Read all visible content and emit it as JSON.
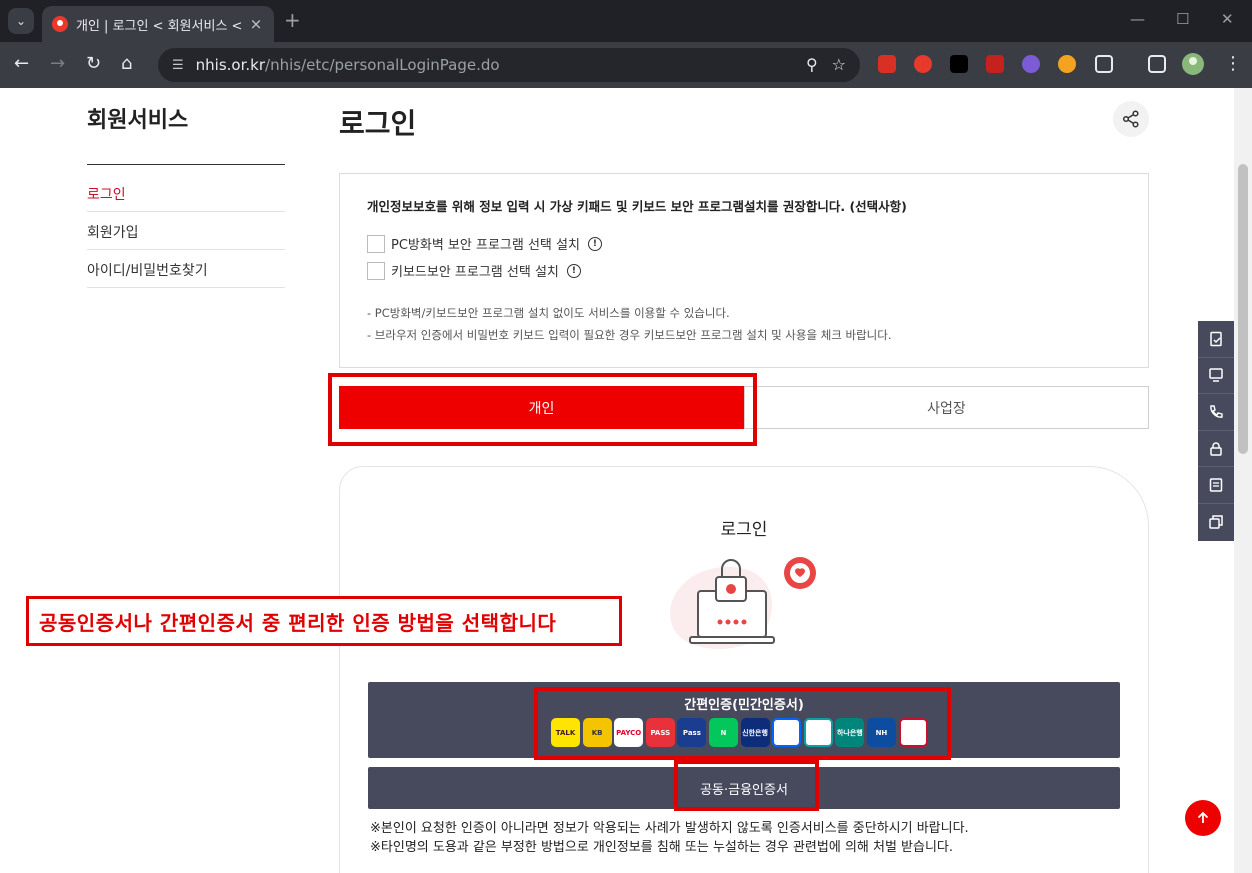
{
  "browser": {
    "tab_title": "개인 | 로그인 < 회원서비스 <",
    "url_host": "nhis.or.kr",
    "url_path": "/nhis/etc/personalLoginPage.do",
    "tab_menu_icon": "chevron-down",
    "new_tab": "+",
    "minimize": "—",
    "maximize": "☐",
    "close": "✕"
  },
  "sidebar": {
    "title": "회원서비스",
    "items": [
      {
        "label": "로그인"
      },
      {
        "label": "회원가입"
      },
      {
        "label": "아이디/비밀번호찾기"
      }
    ]
  },
  "main": {
    "title": "로그인"
  },
  "notice": {
    "heading": "개인정보보호를 위해 정보 입력 시 가상 키패드 및 키보드 보안 프로그램설치를 권장합니다. (선택사항)",
    "options": [
      {
        "label": "PC방화벽 보안 프로그램 선택 설치",
        "checked": false
      },
      {
        "label": "키보드보안 프로그램 선택 설치",
        "checked": false
      }
    ],
    "notes": [
      "-  PC방화벽/키보드보안 프로그램 설치 없이도 서비스를 이용할 수 있습니다.",
      "-  브라우저 인증에서 비밀번호 키보드 입력이 필요한 경우 키보드보안 프로그램 설치 및 사용을 체크 바랍니다."
    ]
  },
  "user_tabs": {
    "individual": "개인",
    "business": "사업장"
  },
  "login_card": {
    "title": "로그인",
    "simple_auth_label": "간편인증(민간인증서)",
    "providers": [
      {
        "name": "kakao",
        "text": "TALK",
        "bg": "#fee500",
        "fg": "#3c1e1e"
      },
      {
        "name": "kb",
        "text": "KB",
        "bg": "#f5c400",
        "fg": "#333"
      },
      {
        "name": "payco",
        "text": "PAYCO",
        "bg": "#ffffff",
        "fg": "#e4002b"
      },
      {
        "name": "pass",
        "text": "PASS",
        "bg": "#e8313b",
        "fg": "#ffffff"
      },
      {
        "name": "samsung-pass",
        "text": "Pass",
        "bg": "#1a3d8f",
        "fg": "#ffffff"
      },
      {
        "name": "naver",
        "text": "N",
        "bg": "#03c75a",
        "fg": "#ffffff"
      },
      {
        "name": "shinhan",
        "text": "신한은행",
        "bg": "#0d2c7a",
        "fg": "#ffffff"
      },
      {
        "name": "toss",
        "text": "",
        "bg": "#ffffff",
        "fg": "#0064ff"
      },
      {
        "name": "woori",
        "text": "",
        "bg": "#ffffff",
        "fg": "#0aa1a5"
      },
      {
        "name": "hana",
        "text": "하나은행",
        "bg": "#00857a",
        "fg": "#ffffff"
      },
      {
        "name": "nh",
        "text": "NH",
        "bg": "#0c4da2",
        "fg": "#ffffff"
      },
      {
        "name": "banksalad",
        "text": "",
        "bg": "#ffffff",
        "fg": "#c8102e"
      }
    ],
    "cert_label": "공동·금융인증서",
    "warnings": [
      "※본인이 요청한 인증이 아니라면 정보가 악용되는 사례가 발생하지 않도록 인증서비스를 중단하시기 바랍니다.",
      "※타인명의 도용과 같은 부정한 방법으로 개인정보를 침해 또는 누설하는 경우 관련법에 의해 처벌 받습니다."
    ]
  },
  "annotation": {
    "text": "공동인증서나 간편인증서 중 편리한 인증 방법을 선택합니다"
  },
  "colors": {
    "accent_red": "#ee0000",
    "active_menu": "#c8102e",
    "dark_button": "#474a5d",
    "annotation_red": "#e00000"
  }
}
